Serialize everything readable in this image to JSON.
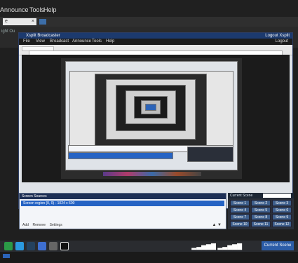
{
  "outer_menu": {
    "items": [
      "Announce",
      "Tools",
      "Help"
    ]
  },
  "outer_tab": {
    "label": "e",
    "close": "×"
  },
  "band": {
    "label": "ight Ou"
  },
  "window": {
    "title": "Xsplit Broadcaster",
    "title_right": "Logout  Xsplit",
    "menu": [
      "File",
      "View",
      "Broadcast",
      "Announce",
      "Tools",
      "Help"
    ],
    "menu_right": "Logout"
  },
  "sources": {
    "header": "Screen Sources",
    "items": [
      "Screen region (0, 0) - 1024 x 600"
    ],
    "footer": {
      "add": "Add",
      "remove": "Remove",
      "settings": "Settings"
    },
    "arrows": "▲ ▼"
  },
  "scenes": {
    "label": "Current Scene",
    "buttons": [
      [
        "Scene 1",
        "Scene 2",
        "Scene 3"
      ],
      [
        "Scene 4",
        "Scene 5",
        "Scene 6"
      ],
      [
        "Scene 7",
        "Scene 8",
        "Scene 9"
      ],
      [
        "Scene 10",
        "Scene 11",
        "Scene 12"
      ]
    ]
  },
  "taskbar": {
    "current_scene": "Current Scene",
    "icons": [
      "chrome-icon",
      "skype-icon",
      "steam-icon",
      "document-icon",
      "settings-icon",
      "media-icon"
    ]
  },
  "colors": {
    "accent": "#2b63b8",
    "title_bar": "#1c3a6e",
    "dark_bg": "#1f1f1f"
  }
}
